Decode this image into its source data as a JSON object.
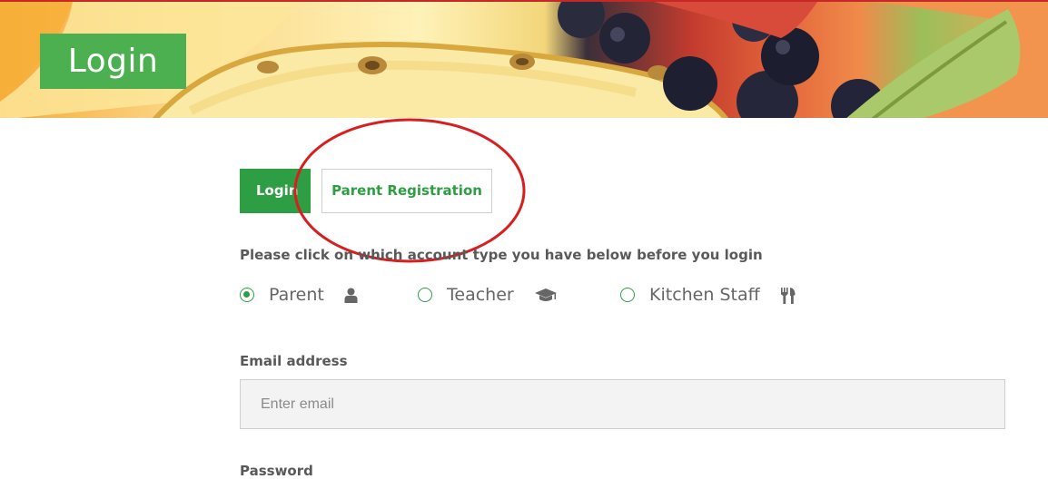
{
  "hero": {
    "title": "Login"
  },
  "tabs": [
    {
      "label": "Login",
      "active": true
    },
    {
      "label": "Parent Registration",
      "active": false
    }
  ],
  "account_type": {
    "instructions": "Please click on which account type you have below before you login",
    "options": [
      {
        "label": "Parent",
        "icon": "user-icon",
        "selected": true
      },
      {
        "label": "Teacher",
        "icon": "graduation-cap-icon",
        "selected": false
      },
      {
        "label": "Kitchen Staff",
        "icon": "cutlery-icon",
        "selected": false
      }
    ]
  },
  "form": {
    "email_label": "Email address",
    "email_placeholder": "Enter email",
    "password_label": "Password"
  },
  "colors": {
    "accent": "#2e9e44",
    "annotation": "#d81e1e",
    "hero_title_bg": "#4caf50"
  }
}
